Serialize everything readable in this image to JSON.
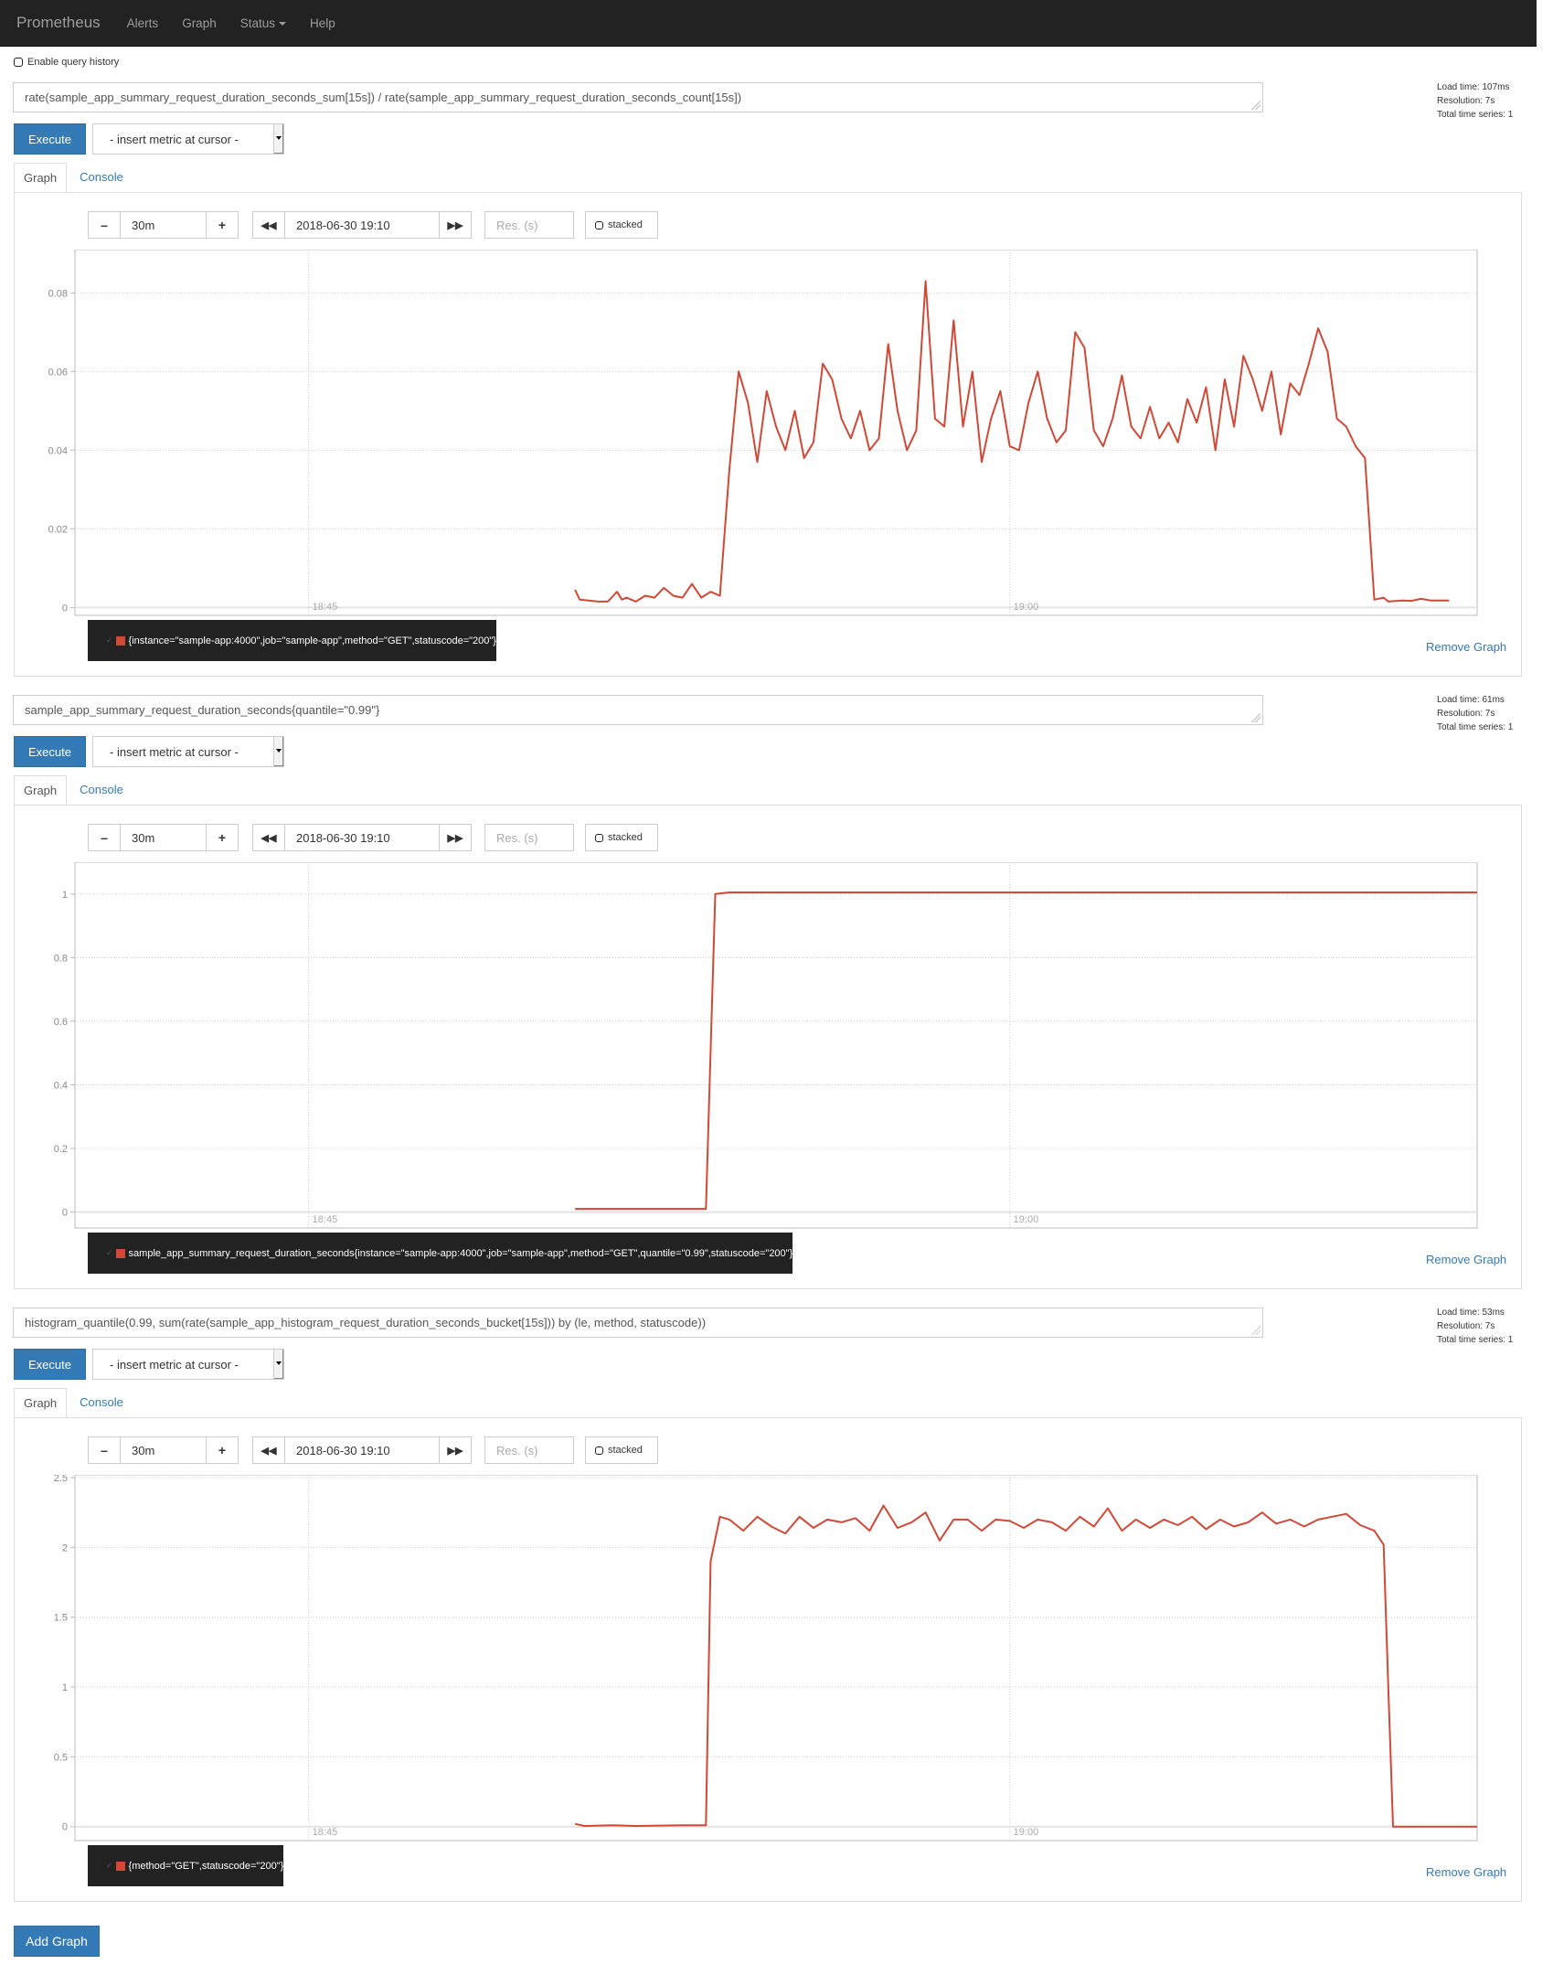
{
  "navbar": {
    "brand": "Prometheus",
    "items": [
      "Alerts",
      "Graph",
      "Status",
      "Help"
    ]
  },
  "history": {
    "label": "Enable query history"
  },
  "panels": [
    {
      "expression": "rate(sample_app_summary_request_duration_seconds_sum[15s]) / rate(sample_app_summary_request_duration_seconds_count[15s])",
      "stats": {
        "load_time": "Load time: 107ms",
        "resolution": "Resolution: 7s",
        "total_series": "Total time series: 1"
      },
      "execute_label": "Execute",
      "metric_select": "- insert metric at cursor -",
      "tabs": [
        "Graph",
        "Console"
      ],
      "range": "30m",
      "end_time": "2018-06-30 19:10",
      "res_placeholder": "Res. (s)",
      "stacked_label": "stacked",
      "legend": "{instance=\"sample-app:4000\",job=\"sample-app\",method=\"GET\",statuscode=\"200\"}",
      "remove_label": "Remove Graph"
    },
    {
      "expression": "sample_app_summary_request_duration_seconds{quantile=\"0.99\"}",
      "stats": {
        "load_time": "Load time: 61ms",
        "resolution": "Resolution: 7s",
        "total_series": "Total time series: 1"
      },
      "execute_label": "Execute",
      "metric_select": "- insert metric at cursor -",
      "tabs": [
        "Graph",
        "Console"
      ],
      "range": "30m",
      "end_time": "2018-06-30 19:10",
      "res_placeholder": "Res. (s)",
      "stacked_label": "stacked",
      "legend": "sample_app_summary_request_duration_seconds{instance=\"sample-app:4000\",job=\"sample-app\",method=\"GET\",quantile=\"0.99\",statuscode=\"200\"}",
      "remove_label": "Remove Graph"
    },
    {
      "expression": "histogram_quantile(0.99, sum(rate(sample_app_histogram_request_duration_seconds_bucket[15s])) by (le, method, statuscode))",
      "stats": {
        "load_time": "Load time: 53ms",
        "resolution": "Resolution: 7s",
        "total_series": "Total time series: 1"
      },
      "execute_label": "Execute",
      "metric_select": "- insert metric at cursor -",
      "tabs": [
        "Graph",
        "Console"
      ],
      "range": "30m",
      "end_time": "2018-06-30 19:10",
      "res_placeholder": "Res. (s)",
      "stacked_label": "stacked",
      "legend": "{method=\"GET\",statuscode=\"200\"}",
      "remove_label": "Remove Graph"
    }
  ],
  "add_graph_label": "Add Graph",
  "chart_data": [
    {
      "type": "line",
      "title": "",
      "xlabel": "",
      "ylabel": "",
      "x_unit": "minutes after 18:40",
      "xlim": [
        0,
        30
      ],
      "x_ticks": [
        {
          "value": 5,
          "label": "18:45"
        },
        {
          "value": 20,
          "label": "19:00"
        }
      ],
      "ylim": [
        -0.002,
        0.091
      ],
      "y_ticks": [
        0,
        0.02,
        0.04,
        0.06,
        0.08
      ],
      "y_tick_labels": [
        "0",
        "0.02",
        "0.04",
        "0.06",
        "0.08"
      ],
      "grid": true,
      "series": [
        {
          "name": "{instance=\"sample-app:4000\",job=\"sample-app\",method=\"GET\",statuscode=\"200\"}",
          "color": "#d14836",
          "x": [
            10.7,
            10.8,
            11.2,
            11.4,
            11.6,
            11.7,
            11.8,
            12.0,
            12.2,
            12.4,
            12.6,
            12.8,
            13.0,
            13.2,
            13.4,
            13.6,
            13.8,
            14.0,
            14.2,
            14.4,
            14.6,
            14.8,
            15.0,
            15.2,
            15.4,
            15.6,
            15.8,
            16.0,
            16.2,
            16.4,
            16.6,
            16.8,
            17.0,
            17.2,
            17.4,
            17.6,
            17.8,
            18.0,
            18.2,
            18.4,
            18.6,
            18.8,
            19.0,
            19.2,
            19.4,
            19.6,
            19.8,
            20.0,
            20.2,
            20.4,
            20.6,
            20.8,
            21.0,
            21.2,
            21.4,
            21.6,
            21.8,
            22.0,
            22.2,
            22.4,
            22.6,
            22.8,
            23.0,
            23.2,
            23.4,
            23.6,
            23.8,
            24.0,
            24.2,
            24.4,
            24.6,
            24.8,
            25.0,
            25.2,
            25.4,
            25.6,
            25.8,
            26.0,
            26.2,
            26.4,
            26.6,
            26.8,
            27.0,
            27.2,
            27.4,
            27.6,
            27.8,
            28.0,
            28.1,
            28.4,
            28.6,
            28.8,
            29.0,
            29.4,
            29.8,
            30.0
          ],
          "y": [
            0.0045,
            0.002,
            0.0015,
            0.0015,
            0.004,
            0.002,
            0.0025,
            0.0015,
            0.003,
            0.0025,
            0.005,
            0.003,
            0.0025,
            0.006,
            0.0025,
            0.004,
            0.003,
            0.035,
            0.06,
            0.052,
            0.037,
            0.055,
            0.046,
            0.04,
            0.05,
            0.038,
            0.042,
            0.062,
            0.058,
            0.048,
            0.043,
            0.05,
            0.04,
            0.043,
            0.067,
            0.05,
            0.04,
            0.045,
            0.083,
            0.048,
            0.046,
            0.073,
            0.046,
            0.06,
            0.037,
            0.048,
            0.055,
            0.041,
            0.04,
            0.052,
            0.06,
            0.048,
            0.042,
            0.045,
            0.07,
            0.066,
            0.045,
            0.041,
            0.048,
            0.059,
            0.046,
            0.043,
            0.051,
            0.043,
            0.047,
            0.042,
            0.053,
            0.047,
            0.056,
            0.04,
            0.058,
            0.046,
            0.064,
            0.058,
            0.05,
            0.06,
            0.044,
            0.057,
            0.054,
            0.062,
            0.071,
            0.065,
            0.048,
            0.046,
            0.041,
            0.038,
            0.002,
            0.0025,
            0.0015,
            0.0018,
            0.0017,
            0.0022,
            0.0018,
            0.0018
          ]
        }
      ]
    },
    {
      "type": "line",
      "title": "",
      "xlabel": "",
      "ylabel": "",
      "x_unit": "minutes after 18:40",
      "xlim": [
        0,
        30
      ],
      "x_ticks": [
        {
          "value": 5,
          "label": "18:45"
        },
        {
          "value": 20,
          "label": "19:00"
        }
      ],
      "ylim": [
        -0.05,
        1.1
      ],
      "y_ticks": [
        0,
        0.2,
        0.4,
        0.6,
        0.8,
        1
      ],
      "y_tick_labels": [
        "0",
        "0.2",
        "0.4",
        "0.6",
        "0.8",
        "1"
      ],
      "grid": true,
      "series": [
        {
          "name": "sample_app_summary_request_duration_seconds{instance=\"sample-app:4000\",job=\"sample-app\",method=\"GET\",quantile=\"0.99\",statuscode=\"200\"}",
          "color": "#d14836",
          "x": [
            10.7,
            13.5,
            13.7,
            14.0,
            30.0
          ],
          "y": [
            0.01,
            0.01,
            1.0,
            1.005,
            1.005
          ]
        }
      ]
    },
    {
      "type": "line",
      "title": "",
      "xlabel": "",
      "ylabel": "",
      "x_unit": "minutes after 18:40",
      "xlim": [
        0,
        30
      ],
      "x_ticks": [
        {
          "value": 5,
          "label": "18:45"
        },
        {
          "value": 20,
          "label": "19:00"
        }
      ],
      "ylim": [
        -0.1,
        2.52
      ],
      "y_ticks": [
        0,
        0.5,
        1,
        1.5,
        2,
        2.5
      ],
      "y_tick_labels": [
        "0",
        "0.5",
        "1",
        "1.5",
        "2",
        "2.5"
      ],
      "grid": true,
      "series": [
        {
          "name": "{method=\"GET\",statuscode=\"200\"}",
          "color": "#d14836",
          "x": [
            10.7,
            10.9,
            11.5,
            12.0,
            13.0,
            13.5,
            13.6,
            13.8,
            14.0,
            14.3,
            14.6,
            14.9,
            15.2,
            15.5,
            15.8,
            16.1,
            16.4,
            16.7,
            17.0,
            17.3,
            17.6,
            17.9,
            18.2,
            18.5,
            18.8,
            19.1,
            19.4,
            19.7,
            20.0,
            20.3,
            20.6,
            20.9,
            21.2,
            21.5,
            21.8,
            22.1,
            22.4,
            22.7,
            23.0,
            23.3,
            23.6,
            23.9,
            24.2,
            24.5,
            24.8,
            25.1,
            25.4,
            25.7,
            26.0,
            26.3,
            26.6,
            26.9,
            27.2,
            27.5,
            27.8,
            28.0,
            28.1,
            28.2,
            29.0,
            30.0
          ],
          "y": [
            0.02,
            0.005,
            0.01,
            0.005,
            0.01,
            0.01,
            1.9,
            2.22,
            2.2,
            2.12,
            2.22,
            2.15,
            2.1,
            2.22,
            2.14,
            2.2,
            2.18,
            2.21,
            2.12,
            2.3,
            2.14,
            2.18,
            2.25,
            2.05,
            2.2,
            2.2,
            2.12,
            2.2,
            2.19,
            2.14,
            2.2,
            2.18,
            2.12,
            2.22,
            2.15,
            2.28,
            2.12,
            2.2,
            2.14,
            2.2,
            2.16,
            2.22,
            2.13,
            2.2,
            2.15,
            2.18,
            2.25,
            2.17,
            2.2,
            2.15,
            2.2,
            2.22,
            2.24,
            2.16,
            2.12,
            2.02,
            1.0,
            0.0,
            0.0,
            0.0
          ]
        }
      ]
    }
  ]
}
